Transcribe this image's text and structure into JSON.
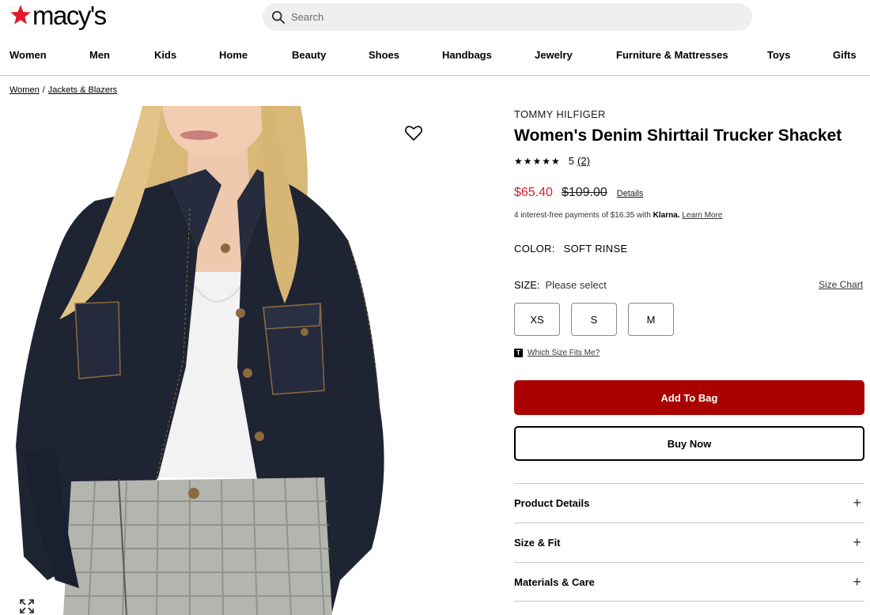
{
  "header": {
    "logo_text": "macy's",
    "search_placeholder": "Search"
  },
  "nav": {
    "items": [
      "Women",
      "Men",
      "Kids",
      "Home",
      "Beauty",
      "Shoes",
      "Handbags",
      "Jewelry",
      "Furniture & Mattresses",
      "Toys",
      "Gifts"
    ]
  },
  "breadcrumb": {
    "items": [
      "Women",
      "Jackets & Blazers"
    ],
    "separator": "/"
  },
  "product": {
    "brand": "TOMMY HILFIGER",
    "title": "Women's Denim Shirttail Trucker Shacket",
    "rating": {
      "stars": "★★★★★",
      "value": "5",
      "count": "(2)"
    },
    "price": {
      "sale": "$65.40",
      "original": "$109.00",
      "details_link": "Details"
    },
    "klarna": {
      "text": "4 interest-free payments of $16.35 with",
      "brand": "Klarna.",
      "link": "Learn More"
    },
    "color": {
      "label": "COLOR:",
      "value": "SOFT RINSE"
    },
    "size": {
      "label": "SIZE:",
      "value": "Please select",
      "chart_link": "Size Chart",
      "options": [
        "XS",
        "S",
        "M"
      ]
    },
    "fit_link": "Which Size Fits Me?",
    "fit_icon": "T",
    "add_to_bag": "Add To Bag",
    "buy_now": "Buy Now",
    "accordions": [
      {
        "label": "Product Details",
        "icon": "+"
      },
      {
        "label": "Size & Fit",
        "icon": "+"
      },
      {
        "label": "Materials & Care",
        "icon": "+"
      }
    ]
  },
  "colors": {
    "brand_red": "#e21a2c",
    "bag_button": "#a90000",
    "denim": "#1f2433"
  },
  "icons": {
    "logo": "star-icon",
    "search": "search-icon",
    "favorite": "heart-icon",
    "expand": "expand-icon"
  }
}
